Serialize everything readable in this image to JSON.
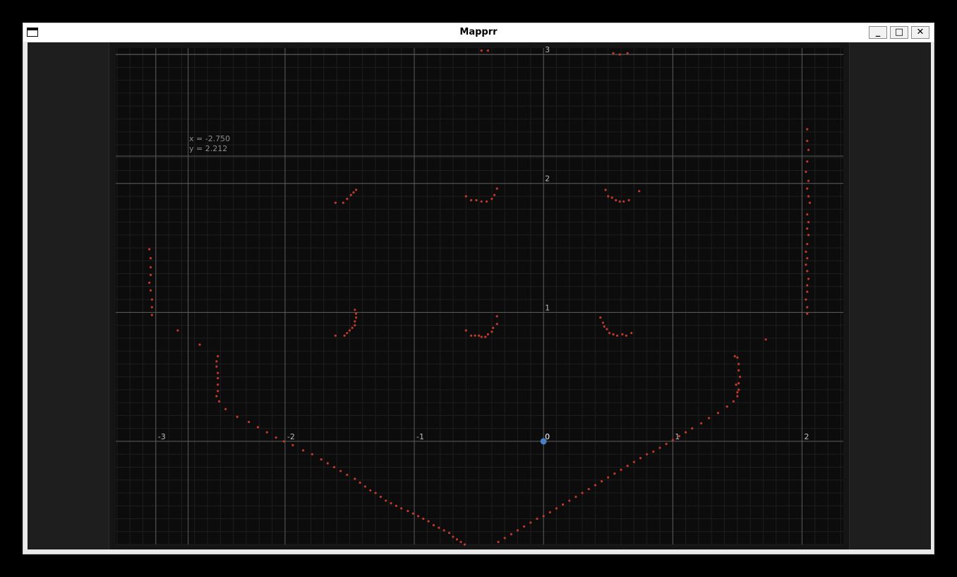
{
  "window": {
    "title": "Mapprr",
    "buttons": {
      "minimize": "_",
      "maximize": "□",
      "close": "✕"
    }
  },
  "readout": {
    "x_text": "x = -2.750",
    "y_text": "y = 2.212"
  },
  "colors": {
    "background": "#0c0c0c",
    "grid_minor": "#1e1e1e",
    "grid_major": "#5c5c5c",
    "point": "#c0392b",
    "origin_marker": "#4a7fc1",
    "tick_label": "#bdbdbd"
  },
  "chart_data": {
    "type": "scatter",
    "xlim": [
      -3.31,
      2.32
    ],
    "ylim": [
      -0.8,
      3.05
    ],
    "grid": true,
    "minor_grid": true,
    "x_ticks": [
      -3,
      -2,
      -1,
      0,
      1,
      2
    ],
    "y_ticks": [
      1,
      2,
      3
    ],
    "x_tick_labels": [
      "-3",
      "-2",
      "-1",
      "0",
      "1",
      "2"
    ],
    "y_tick_labels": [
      "1",
      "2",
      "3"
    ],
    "origin_label": "0",
    "extra_lines": {
      "vertical_x": [
        -2.75
      ],
      "horizontal_y": [
        2.212,
        3.0
      ]
    },
    "origin_marker": [
      0,
      0
    ],
    "points": [
      [
        -0.48,
        3.03
      ],
      [
        -0.43,
        3.03
      ],
      [
        0.54,
        3.01
      ],
      [
        0.59,
        3.0
      ],
      [
        0.65,
        3.01
      ],
      [
        2.04,
        2.42
      ],
      [
        2.04,
        2.33
      ],
      [
        2.05,
        2.26
      ],
      [
        2.04,
        2.17
      ],
      [
        2.03,
        2.09
      ],
      [
        2.05,
        2.02
      ],
      [
        2.04,
        1.96
      ],
      [
        2.05,
        1.9
      ],
      [
        2.06,
        1.85
      ],
      [
        2.04,
        1.76
      ],
      [
        2.05,
        1.7
      ],
      [
        2.04,
        1.65
      ],
      [
        2.05,
        1.6
      ],
      [
        2.04,
        1.53
      ],
      [
        2.03,
        1.47
      ],
      [
        2.04,
        1.42
      ],
      [
        2.03,
        1.37
      ],
      [
        2.04,
        1.32
      ],
      [
        2.05,
        1.26
      ],
      [
        2.04,
        1.21
      ],
      [
        2.04,
        1.16
      ],
      [
        2.03,
        1.1
      ],
      [
        2.04,
        1.04
      ],
      [
        2.04,
        0.99
      ],
      [
        -3.05,
        1.49
      ],
      [
        -3.04,
        1.42
      ],
      [
        -3.04,
        1.35
      ],
      [
        -3.04,
        1.29
      ],
      [
        -3.05,
        1.23
      ],
      [
        -3.04,
        1.17
      ],
      [
        -3.03,
        1.1
      ],
      [
        -3.03,
        1.04
      ],
      [
        -3.03,
        0.98
      ],
      [
        -2.83,
        0.86
      ],
      [
        -2.66,
        0.75
      ],
      [
        -1.61,
        1.85
      ],
      [
        -1.55,
        1.85
      ],
      [
        -1.52,
        1.88
      ],
      [
        -1.49,
        1.91
      ],
      [
        -1.47,
        1.93
      ],
      [
        -1.45,
        1.95
      ],
      [
        -0.6,
        1.9
      ],
      [
        -0.56,
        1.87
      ],
      [
        -0.52,
        1.87
      ],
      [
        -0.48,
        1.86
      ],
      [
        -0.44,
        1.86
      ],
      [
        -0.4,
        1.88
      ],
      [
        -0.38,
        1.91
      ],
      [
        -0.36,
        1.96
      ],
      [
        0.48,
        1.95
      ],
      [
        0.5,
        1.9
      ],
      [
        0.53,
        1.89
      ],
      [
        0.56,
        1.87
      ],
      [
        0.59,
        1.86
      ],
      [
        0.62,
        1.86
      ],
      [
        0.66,
        1.87
      ],
      [
        0.74,
        1.94
      ],
      [
        -1.61,
        0.82
      ],
      [
        -1.54,
        0.82
      ],
      [
        -1.52,
        0.84
      ],
      [
        -1.5,
        0.86
      ],
      [
        -1.48,
        0.88
      ],
      [
        -1.46,
        0.9
      ],
      [
        -1.46,
        0.93
      ],
      [
        -1.45,
        0.96
      ],
      [
        -1.45,
        0.99
      ],
      [
        -1.46,
        1.02
      ],
      [
        -0.6,
        0.86
      ],
      [
        -0.56,
        0.82
      ],
      [
        -0.53,
        0.82
      ],
      [
        -0.5,
        0.82
      ],
      [
        -0.48,
        0.81
      ],
      [
        -0.45,
        0.81
      ],
      [
        -0.43,
        0.83
      ],
      [
        -0.4,
        0.85
      ],
      [
        -0.39,
        0.88
      ],
      [
        -0.36,
        0.91
      ],
      [
        -0.36,
        0.97
      ],
      [
        0.44,
        0.96
      ],
      [
        0.46,
        0.92
      ],
      [
        0.47,
        0.89
      ],
      [
        0.49,
        0.87
      ],
      [
        0.51,
        0.84
      ],
      [
        0.54,
        0.83
      ],
      [
        0.57,
        0.82
      ],
      [
        0.61,
        0.83
      ],
      [
        0.64,
        0.82
      ],
      [
        0.68,
        0.84
      ],
      [
        1.72,
        0.79
      ],
      [
        -2.52,
        0.66
      ],
      [
        -2.53,
        0.62
      ],
      [
        -2.53,
        0.58
      ],
      [
        -2.52,
        0.53
      ],
      [
        -2.52,
        0.49
      ],
      [
        -2.52,
        0.44
      ],
      [
        -2.52,
        0.39
      ],
      [
        -2.53,
        0.35
      ],
      [
        -2.51,
        0.31
      ],
      [
        -2.46,
        0.25
      ],
      [
        -2.37,
        0.19
      ],
      [
        -2.28,
        0.15
      ],
      [
        -2.21,
        0.11
      ],
      [
        -2.14,
        0.07
      ],
      [
        -2.07,
        0.03
      ],
      [
        -2.01,
        0.0
      ],
      [
        -1.94,
        -0.03
      ],
      [
        -1.86,
        -0.07
      ],
      [
        -1.79,
        -0.1
      ],
      [
        -1.72,
        -0.14
      ],
      [
        -1.67,
        -0.17
      ],
      [
        -1.62,
        -0.2
      ],
      [
        -1.57,
        -0.23
      ],
      [
        -1.52,
        -0.26
      ],
      [
        -1.46,
        -0.29
      ],
      [
        -1.42,
        -0.32
      ],
      [
        -1.38,
        -0.35
      ],
      [
        -1.34,
        -0.38
      ],
      [
        -1.3,
        -0.4
      ],
      [
        -1.26,
        -0.43
      ],
      [
        -1.22,
        -0.46
      ],
      [
        -1.18,
        -0.48
      ],
      [
        -1.14,
        -0.5
      ],
      [
        -1.1,
        -0.52
      ],
      [
        -1.05,
        -0.54
      ],
      [
        -1.01,
        -0.56
      ],
      [
        -0.97,
        -0.58
      ],
      [
        -0.93,
        -0.6
      ],
      [
        -0.89,
        -0.62
      ],
      [
        -0.85,
        -0.65
      ],
      [
        -0.81,
        -0.67
      ],
      [
        -0.77,
        -0.69
      ],
      [
        -0.73,
        -0.71
      ],
      [
        -0.7,
        -0.74
      ],
      [
        -0.67,
        -0.76
      ],
      [
        -0.64,
        -0.78
      ],
      [
        -0.61,
        -0.8
      ],
      [
        -0.35,
        -0.78
      ],
      [
        -0.3,
        -0.75
      ],
      [
        -0.25,
        -0.72
      ],
      [
        -0.2,
        -0.69
      ],
      [
        -0.15,
        -0.66
      ],
      [
        -0.1,
        -0.63
      ],
      [
        -0.05,
        -0.6
      ],
      [
        0.0,
        -0.58
      ],
      [
        0.05,
        -0.55
      ],
      [
        0.1,
        -0.52
      ],
      [
        0.15,
        -0.49
      ],
      [
        0.2,
        -0.46
      ],
      [
        0.25,
        -0.43
      ],
      [
        0.3,
        -0.4
      ],
      [
        0.35,
        -0.37
      ],
      [
        0.4,
        -0.34
      ],
      [
        0.45,
        -0.31
      ],
      [
        0.5,
        -0.28
      ],
      [
        0.55,
        -0.25
      ],
      [
        0.6,
        -0.22
      ],
      [
        0.65,
        -0.19
      ],
      [
        0.7,
        -0.16
      ],
      [
        0.75,
        -0.13
      ],
      [
        0.8,
        -0.1
      ],
      [
        0.85,
        -0.08
      ],
      [
        0.9,
        -0.05
      ],
      [
        0.95,
        -0.02
      ],
      [
        1.0,
        0.01
      ],
      [
        1.05,
        0.04
      ],
      [
        1.1,
        0.07
      ],
      [
        1.15,
        0.1
      ],
      [
        1.22,
        0.14
      ],
      [
        1.28,
        0.18
      ],
      [
        1.35,
        0.22
      ],
      [
        1.42,
        0.27
      ],
      [
        1.47,
        0.31
      ],
      [
        1.5,
        0.35
      ],
      [
        1.51,
        0.4
      ],
      [
        1.51,
        0.45
      ],
      [
        1.52,
        0.5
      ],
      [
        1.51,
        0.55
      ],
      [
        1.51,
        0.6
      ],
      [
        1.5,
        0.65
      ],
      [
        1.48,
        0.66
      ],
      [
        1.49,
        0.44
      ],
      [
        1.5,
        0.38
      ]
    ]
  }
}
